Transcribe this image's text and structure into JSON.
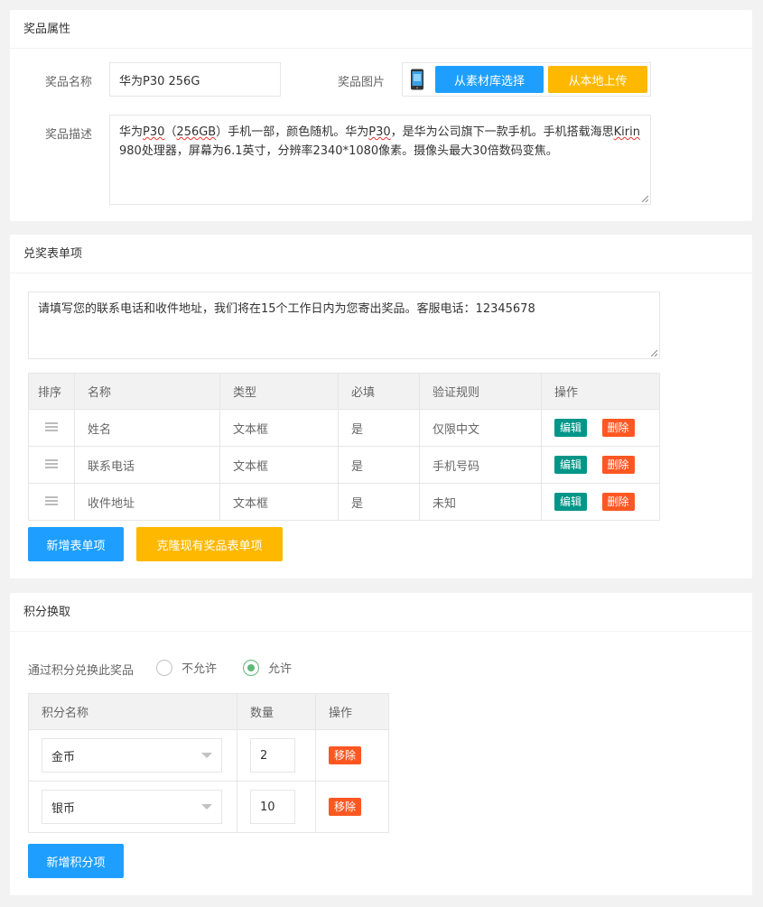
{
  "prize_attr": {
    "title": "奖品属性",
    "name_label": "奖品名称",
    "name_value": "华为P30 256G",
    "image_label": "奖品图片",
    "btn_library": "从素材库选择",
    "btn_local": "从本地上传",
    "desc_label": "奖品描述",
    "desc_parts": [
      "华为",
      "P30",
      "（",
      "256GB",
      "）手机一部，颜色随机。华为",
      "P30",
      "，是华为公司旗下一款手机。手机搭载海思",
      "Kirin",
      " 980处理器，屏幕为6.1英寸，分辨率2340*1080像素。摄像头最大30倍数码变焦。"
    ]
  },
  "form_items": {
    "title": "兑奖表单项",
    "notice": "请填写您的联系电话和收件地址，我们将在15个工作日内为您寄出奖品。客服电话：12345678",
    "headers": [
      "排序",
      "名称",
      "类型",
      "必填",
      "验证规则",
      "操作"
    ],
    "rows": [
      {
        "name": "姓名",
        "type": "文本框",
        "required": "是",
        "rule": "仅限中文",
        "edit": "编辑",
        "delete": "删除"
      },
      {
        "name": "联系电话",
        "type": "文本框",
        "required": "是",
        "rule": "手机号码",
        "edit": "编辑",
        "delete": "删除"
      },
      {
        "name": "收件地址",
        "type": "文本框",
        "required": "是",
        "rule": "未知",
        "edit": "编辑",
        "delete": "删除"
      }
    ],
    "btn_add": "新增表单项",
    "btn_clone": "克隆现有奖品表单项"
  },
  "points": {
    "title": "积分换取",
    "allow_label": "通过积分兑换此奖品",
    "option_deny": "不允许",
    "option_allow": "允许",
    "selected": "允许",
    "headers": [
      "积分名称",
      "数量",
      "操作"
    ],
    "rows": [
      {
        "currency": "金币",
        "amount": "2",
        "remove": "移除"
      },
      {
        "currency": "银币",
        "amount": "10",
        "remove": "移除"
      }
    ],
    "btn_add": "新增积分项"
  },
  "colors": {
    "blue": "#1e9fff",
    "yellow": "#ffb800",
    "green": "#009688",
    "red": "#ff5722",
    "radio_on": "#5fb878"
  },
  "icons": [
    "phone-thumbnail-icon",
    "drag-handle-icon",
    "radio-icon",
    "chevron-down-icon"
  ]
}
